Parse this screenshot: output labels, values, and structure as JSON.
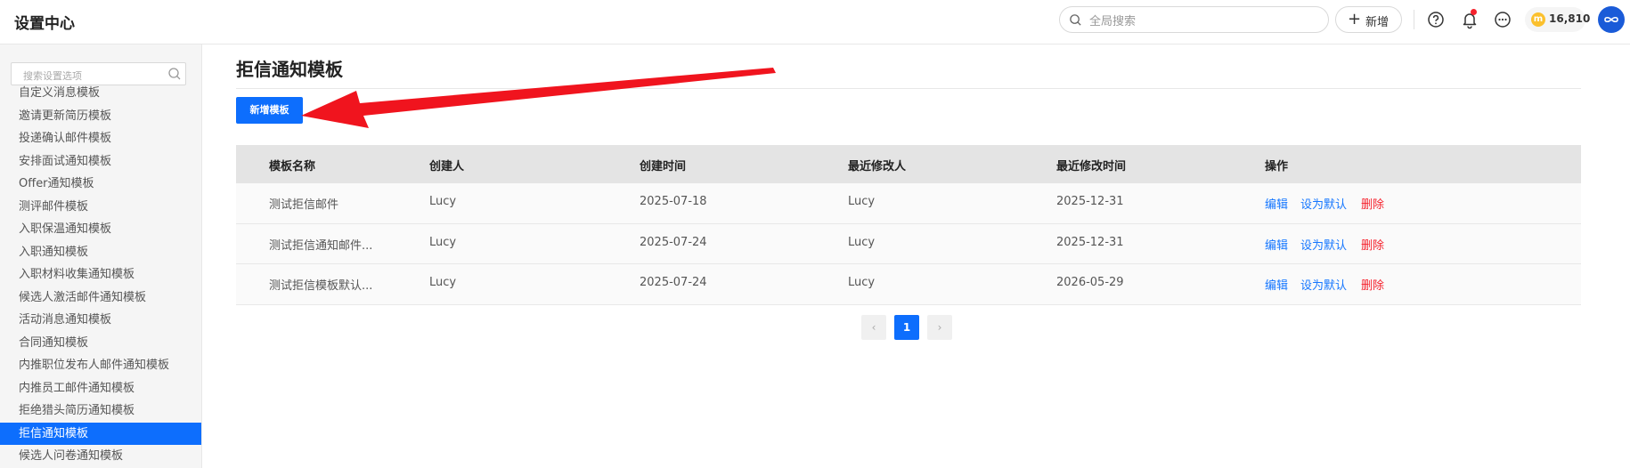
{
  "header": {
    "title": "设置中心",
    "search_placeholder": "全局搜索",
    "new_label": "新增",
    "coins": "16,810"
  },
  "sidebar": {
    "search_placeholder": "搜索设置选项",
    "items": [
      {
        "label": "自定义消息模板",
        "active": false
      },
      {
        "label": "邀请更新简历模板",
        "active": false
      },
      {
        "label": "投递确认邮件模板",
        "active": false
      },
      {
        "label": "安排面试通知模板",
        "active": false
      },
      {
        "label": "Offer通知模板",
        "active": false
      },
      {
        "label": "测评邮件模板",
        "active": false
      },
      {
        "label": "入职保温通知模板",
        "active": false
      },
      {
        "label": "入职通知模板",
        "active": false
      },
      {
        "label": "入职材料收集通知模板",
        "active": false
      },
      {
        "label": "候选人激活邮件通知模板",
        "active": false
      },
      {
        "label": "活动消息通知模板",
        "active": false
      },
      {
        "label": "合同通知模板",
        "active": false
      },
      {
        "label": "内推职位发布人邮件通知模板",
        "active": false
      },
      {
        "label": "内推员工邮件通知模板",
        "active": false
      },
      {
        "label": "拒绝猎头简历通知模板",
        "active": false
      },
      {
        "label": "拒信通知模板",
        "active": true
      },
      {
        "label": "候选人问卷通知模板",
        "active": false
      }
    ]
  },
  "main": {
    "page_title": "拒信通知模板",
    "add_button": "新增模板",
    "columns": [
      "模板名称",
      "创建人",
      "创建时间",
      "最近修改人",
      "最近修改时间",
      "操作"
    ],
    "rows": [
      {
        "name": "测试拒信邮件",
        "creator": "Lucy",
        "created": "2025-07-18",
        "modifier": "Lucy",
        "modified": "2025-12-31"
      },
      {
        "name": "测试拒信通知邮件...",
        "creator": "Lucy",
        "created": "2025-07-24",
        "modifier": "Lucy",
        "modified": "2025-12-31"
      },
      {
        "name": "测试拒信模板默认...",
        "creator": "Lucy",
        "created": "2025-07-24",
        "modifier": "Lucy",
        "modified": "2026-05-29"
      }
    ],
    "actions": {
      "edit": "编辑",
      "set_default": "设为默认",
      "delete": "删除"
    },
    "pagination": {
      "prev": "‹",
      "current": "1",
      "next": "›"
    }
  }
}
